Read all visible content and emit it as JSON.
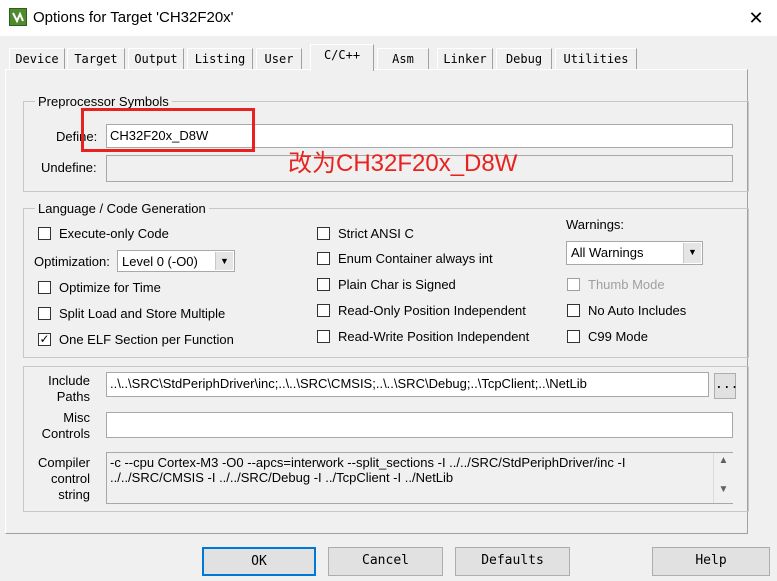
{
  "window": {
    "title": "Options for Target 'CH32F20x'",
    "close": "✕"
  },
  "tabs": [
    {
      "label": "Device"
    },
    {
      "label": "Target"
    },
    {
      "label": "Output"
    },
    {
      "label": "Listing"
    },
    {
      "label": "User"
    },
    {
      "label": "C/C++"
    },
    {
      "label": "Asm"
    },
    {
      "label": "Linker"
    },
    {
      "label": "Debug"
    },
    {
      "label": "Utilities"
    }
  ],
  "active_tab": "C/C++",
  "preprocessor": {
    "group_title": "Preprocessor Symbols",
    "define_label": "Define:",
    "define_value": "CH32F20x_D8W",
    "undefine_label": "Undefine:",
    "undefine_value": ""
  },
  "annotation": {
    "text": "改为CH32F20x_D8W",
    "color": "#e8231f"
  },
  "codegen": {
    "group_title": "Language / Code Generation",
    "execute_only": {
      "label": "Execute-only Code",
      "checked": false
    },
    "optimization_label": "Optimization:",
    "optimization_value": "Level 0 (-O0)",
    "optimize_time": {
      "label": "Optimize for Time",
      "checked": false
    },
    "split_load": {
      "label": "Split Load and Store Multiple",
      "checked": false
    },
    "one_elf": {
      "label": "One ELF Section per Function",
      "checked": true,
      "mark": "✓"
    },
    "strict_ansi": {
      "label": "Strict ANSI C",
      "checked": false
    },
    "enum_container": {
      "label": "Enum Container always int",
      "checked": false
    },
    "plain_char": {
      "label": "Plain Char is Signed",
      "checked": false
    },
    "ro_pos": {
      "label": "Read-Only Position Independent",
      "checked": false
    },
    "rw_pos": {
      "label": "Read-Write Position Independent",
      "checked": false
    },
    "warnings_label": "Warnings:",
    "warnings_value": "All Warnings",
    "thumb_mode": {
      "label": "Thumb Mode",
      "checked": false,
      "disabled": true
    },
    "no_auto_includes": {
      "label": "No Auto Includes",
      "checked": false
    },
    "c99_mode": {
      "label": "C99 Mode",
      "checked": false
    }
  },
  "paths": {
    "include_label_1": "Include",
    "include_label_2": "Paths",
    "include_value": "..\\..\\SRC\\StdPeriphDriver\\inc;..\\..\\SRC\\CMSIS;..\\..\\SRC\\Debug;..\\TcpClient;..\\NetLib",
    "browse_label": "...",
    "misc_label_1": "Misc",
    "misc_label_2": "Controls",
    "misc_value": "",
    "compiler_label_1": "Compiler",
    "compiler_label_2": "control",
    "compiler_label_3": "string",
    "compiler_line_1": "-c --cpu Cortex-M3 -O0 --apcs=interwork --split_sections -I ../../SRC/StdPeriphDriver/inc -I",
    "compiler_line_2": "../../SRC/CMSIS -I ../../SRC/Debug -I ../TcpClient -I ../NetLib"
  },
  "buttons": {
    "ok": "OK",
    "cancel": "Cancel",
    "defaults": "Defaults",
    "help": "Help"
  }
}
